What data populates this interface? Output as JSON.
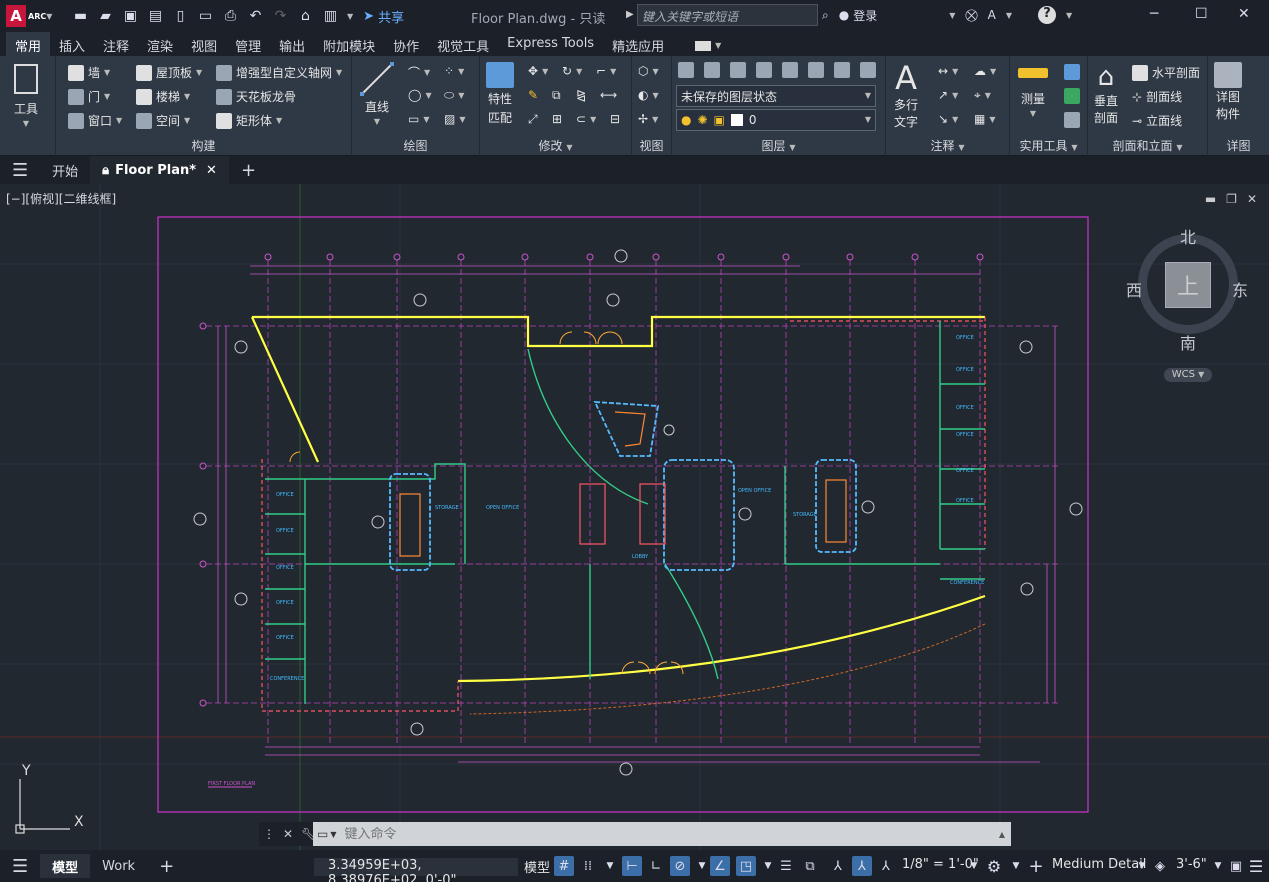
{
  "app": {
    "logo_text": "A",
    "logo_sub": "ARC",
    "doc_title": "Floor Plan.dwg - 只读",
    "share_label": "共享",
    "search_placeholder": "键入关键字或短语",
    "login_label": "登录"
  },
  "ribbon_tabs": [
    "常用",
    "插入",
    "注释",
    "渲染",
    "视图",
    "管理",
    "输出",
    "附加模块",
    "协作",
    "视觉工具",
    "Express Tools",
    "精选应用"
  ],
  "panels": {
    "tools": {
      "label": "工具"
    },
    "build": {
      "label": "构建",
      "wall": "墙",
      "door": "门",
      "window": "窗口",
      "roof": "屋顶板",
      "stair": "楼梯",
      "space": "空间",
      "grid": "增强型自定义轴网",
      "ceiling": "天花板龙骨",
      "box": "矩形体"
    },
    "draw": {
      "label": "绘图",
      "line": "直线"
    },
    "modify": {
      "label": "修改",
      "match": "特性\n匹配",
      "match1": "特性",
      "match2": "匹配"
    },
    "view": {
      "label": "视图"
    },
    "layers": {
      "label": "图层",
      "state": "未保存的图层状态",
      "current": "0"
    },
    "annotate": {
      "label": "注释",
      "mtext1": "多行",
      "mtext2": "文字"
    },
    "utils": {
      "label": "实用工具",
      "measure": "测量"
    },
    "section": {
      "label": "剖面和立面",
      "vertical1": "垂直",
      "vertical2": "剖面",
      "hsec": "水平剖面",
      "secline": "剖面线",
      "elevline": "立面线"
    },
    "detail": {
      "label": "详图",
      "dc1": "详图",
      "dc2": "构件"
    }
  },
  "doc_tabs": {
    "start": "开始",
    "active": "Floor Plan*"
  },
  "viewport": {
    "label": "[−][俯视][二维线框]"
  },
  "viewcube": {
    "north": "北",
    "south": "南",
    "east": "东",
    "west": "西",
    "top": "上",
    "wcs": "WCS"
  },
  "drawing": {
    "sheet_title": "FIRST FLOOR PLAN"
  },
  "command": {
    "placeholder": "键入命令"
  },
  "status": {
    "tab_model": "模型",
    "tab_work": "Work",
    "coords": "3.34959E+03, 8.38976E+02, 0'-0\"",
    "model_label": "模型",
    "scale": "1/8\" = 1'-0\"",
    "detail": "Medium Detail",
    "elevation": "3'-6\""
  },
  "colors": {
    "accent": "#3c6ea8",
    "magenta": "#cc33cc",
    "yellow": "#ffff44",
    "cyan": "#44bbff",
    "green": "#33cc88"
  }
}
